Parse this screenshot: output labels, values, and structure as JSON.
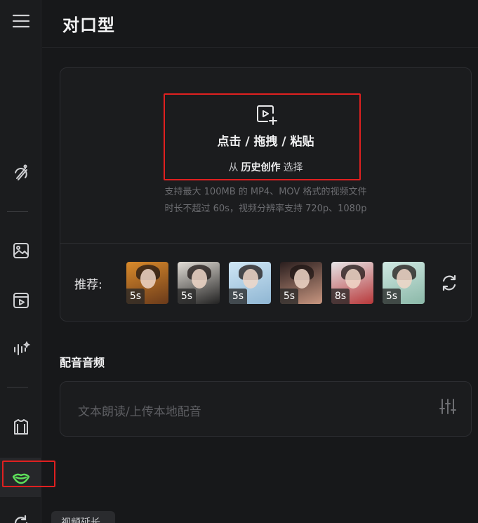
{
  "page": {
    "title": "对口型"
  },
  "sidebar": {
    "items": [
      {
        "name": "menu",
        "icon": "menu-icon"
      },
      {
        "name": "magic",
        "icon": "magic-brush-icon"
      },
      {
        "name": "image",
        "icon": "image-icon"
      },
      {
        "name": "video",
        "icon": "video-icon"
      },
      {
        "name": "audio",
        "icon": "audio-wave-icon"
      },
      {
        "name": "outfit",
        "icon": "shirt-icon"
      },
      {
        "name": "lipsync",
        "icon": "lips-icon",
        "active": true
      },
      {
        "name": "refresh",
        "icon": "rotate-icon"
      }
    ]
  },
  "upload": {
    "main_text": "点击 / 拖拽 / 粘贴",
    "sub_prefix": "从",
    "sub_link": "历史创作",
    "sub_suffix": "选择",
    "hint_line1": "支持最大 100MB 的 MP4、MOV 格式的视频文件",
    "hint_line2": "时长不超过 60s，视频分辨率支持 720p、1080p"
  },
  "recommend": {
    "label": "推荐:",
    "items": [
      {
        "duration": "5s",
        "palette": [
          "#d98a2b",
          "#6a3a1a"
        ]
      },
      {
        "duration": "5s",
        "palette": [
          "#e2ddd6",
          "#222"
        ]
      },
      {
        "duration": "5s",
        "palette": [
          "#cfe6f5",
          "#8fb6d3"
        ]
      },
      {
        "duration": "5s",
        "palette": [
          "#2a1e1e",
          "#c89680"
        ]
      },
      {
        "duration": "8s",
        "palette": [
          "#e6e6e8",
          "#b8383a"
        ]
      },
      {
        "duration": "5s",
        "palette": [
          "#cfe8e2",
          "#8bb8a8"
        ]
      }
    ]
  },
  "audio": {
    "section_title": "配音音频",
    "placeholder": "文本朗读/上传本地配音"
  },
  "bottom_chip": {
    "label": "视频延长"
  },
  "colors": {
    "accent_green": "#5ee05a",
    "highlight_red": "#e02020"
  }
}
